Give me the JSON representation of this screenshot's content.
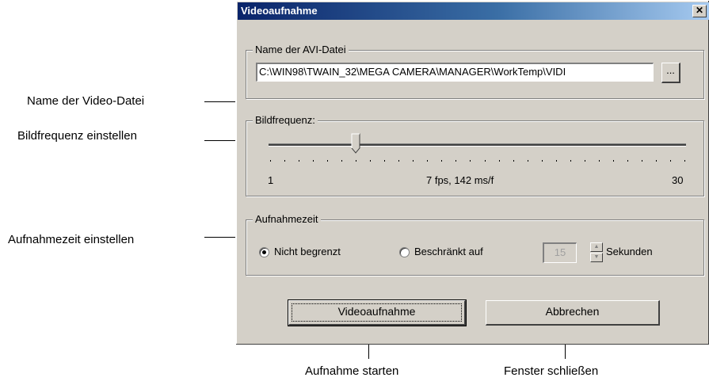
{
  "callouts": {
    "video_file_name": "Name der Video-Datei",
    "frame_rate": "Bildfrequenz einstellen",
    "recording_time": "Aufnahmezeit einstellen",
    "start_recording": "Aufnahme starten",
    "close_window": "Fenster schließen"
  },
  "dialog": {
    "title": "Videoaufnahme",
    "close_glyph": "✕",
    "file_group": {
      "label": "Name der AVI-Datei",
      "path": "C:\\WIN98\\TWAIN_32\\MEGA CAMERA\\MANAGER\\WorkTemp\\VIDI",
      "browse_label": "..."
    },
    "framerate_group": {
      "label": "Bildfrequenz:",
      "min_label": "1",
      "max_label": "30",
      "current_label": "7 fps, 142 ms/f",
      "slider": {
        "min": 1,
        "max": 30,
        "value": 7
      }
    },
    "time_group": {
      "label": "Aufnahmezeit",
      "option_unlimited": "Nicht begrenzt",
      "option_limited": "Beschränkt auf",
      "selected": "unlimited",
      "seconds_value": "15",
      "seconds_unit": "Sekunden"
    },
    "buttons": {
      "record": "Videoaufnahme",
      "cancel": "Abbrechen"
    }
  }
}
